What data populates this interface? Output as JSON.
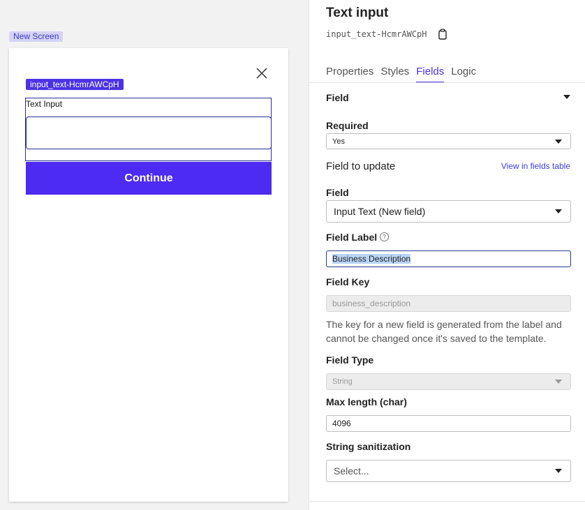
{
  "canvas": {
    "screen_tag": "New Screen",
    "selection_tag": "input_text-HcmrAWCpH",
    "text_input_label": "Text Input",
    "continue_label": "Continue"
  },
  "panel": {
    "title": "Text input",
    "component_id": "input_text-HcmrAWCpH",
    "tabs": [
      "Properties",
      "Styles",
      "Fields",
      "Logic"
    ],
    "active_tab": "Fields",
    "section": "Field",
    "required_label": "Required",
    "required_value": "Yes",
    "field_to_update": "Field to update",
    "view_link": "View in fields table",
    "field_label": "Field",
    "field_value": "Input Text (New field)",
    "field_label_label": "Field Label",
    "field_label_value": "Business Description",
    "field_key_label": "Field Key",
    "field_key_value": "business_description",
    "field_key_help": "The key for a new field is generated from the label and cannot be changed once it's saved to the template.",
    "field_type_label": "Field Type",
    "field_type_value": "String",
    "max_length_label": "Max length (char)",
    "max_length_value": "4096",
    "sanitization_label": "String sanitization",
    "sanitization_placeholder": "Select..."
  },
  "colors": {
    "accent": "#4b32e6",
    "button": "#4e2bf2",
    "link": "#3c3ce0"
  }
}
